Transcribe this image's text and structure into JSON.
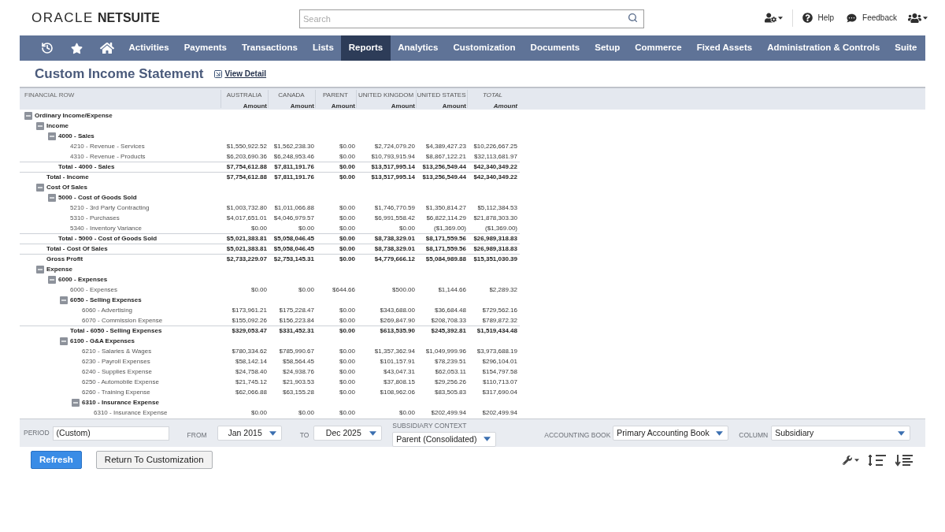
{
  "header": {
    "logo": {
      "brand": "ORACLE",
      "product": "NETSUITE"
    },
    "search": {
      "placeholder": "Search"
    },
    "help_label": "Help",
    "feedback_label": "Feedback"
  },
  "nav": {
    "items": [
      {
        "label": "Activities",
        "selected": false
      },
      {
        "label": "Payments",
        "selected": false
      },
      {
        "label": "Transactions",
        "selected": false
      },
      {
        "label": "Lists",
        "selected": false
      },
      {
        "label": "Reports",
        "selected": true
      },
      {
        "label": "Analytics",
        "selected": false
      },
      {
        "label": "Customization",
        "selected": false
      },
      {
        "label": "Documents",
        "selected": false
      },
      {
        "label": "Setup",
        "selected": false
      },
      {
        "label": "Commerce",
        "selected": false
      },
      {
        "label": "Fixed Assets",
        "selected": false
      },
      {
        "label": "Administration & Controls",
        "selected": false
      },
      {
        "label": "Suite",
        "selected": false
      }
    ]
  },
  "page_title": "Custom Income Statement",
  "view_detail_link": "View Detail",
  "table": {
    "label_column": "FINANCIAL ROW",
    "columns": [
      {
        "name": "AUSTRALIA",
        "sub": "Amount",
        "kind": "subsidiary"
      },
      {
        "name": "CANADA",
        "sub": "Amount",
        "kind": "subsidiary"
      },
      {
        "name": "PARENT",
        "sub": "Amount",
        "kind": "subsidiary"
      },
      {
        "name": "UNITED KINGDOM",
        "sub": "Amount",
        "kind": "subsidiary"
      },
      {
        "name": "UNITED STATES",
        "sub": "Amount",
        "kind": "subsidiary"
      },
      {
        "name": "TOTAL",
        "sub": "Amount",
        "kind": "total"
      }
    ],
    "rows": [
      {
        "label": "Ordinary Income/Expense",
        "kind": "group",
        "expanded": true,
        "children": [
          {
            "label": "Income",
            "kind": "group",
            "expanded": true,
            "children": [
              {
                "label": "4000 - Sales",
                "kind": "group",
                "expanded": true,
                "children": [
                  {
                    "label": "4210 - Revenue - Services",
                    "kind": "account",
                    "amounts": [
                      "$1,550,922.52",
                      "$1,562,238.30",
                      "$0.00",
                      "$2,724,079.20",
                      "$4,389,427.23",
                      "$10,226,667.25"
                    ]
                  },
                  {
                    "label": "4310 - Revenue - Products",
                    "kind": "account",
                    "amounts": [
                      "$6,203,690.36",
                      "$6,248,953.46",
                      "$0.00",
                      "$10,793,915.94",
                      "$8,867,122.21",
                      "$32,113,681.97"
                    ]
                  }
                ],
                "total": {
                  "label": "Total - 4000 - Sales",
                  "amounts": [
                    "$7,754,612.88",
                    "$7,811,191.76",
                    "$0.00",
                    "$13,517,995.14",
                    "$13,256,549.44",
                    "$42,340,349.22"
                  ]
                }
              }
            ],
            "total": {
              "label": "Total - Income",
              "amounts": [
                "$7,754,612.88",
                "$7,811,191.76",
                "$0.00",
                "$13,517,995.14",
                "$13,256,549.44",
                "$42,340,349.22"
              ]
            }
          },
          {
            "label": "Cost Of Sales",
            "kind": "group",
            "expanded": true,
            "children": [
              {
                "label": "5000 - Cost of Goods Sold",
                "kind": "group",
                "expanded": true,
                "children": [
                  {
                    "label": "5210 - 3rd Party Contracting",
                    "kind": "account",
                    "amounts": [
                      "$1,003,732.80",
                      "$1,011,066.88",
                      "$0.00",
                      "$1,746,770.59",
                      "$1,350,814.27",
                      "$5,112,384.53"
                    ]
                  },
                  {
                    "label": "5310 - Purchases",
                    "kind": "account",
                    "amounts": [
                      "$4,017,651.01",
                      "$4,046,979.57",
                      "$0.00",
                      "$6,991,558.42",
                      "$6,822,114.29",
                      "$21,878,303.30"
                    ]
                  },
                  {
                    "label": "5340 - Inventory Variance",
                    "kind": "account",
                    "amounts": [
                      "$0.00",
                      "$0.00",
                      "$0.00",
                      "$0.00",
                      "($1,369.00)",
                      "($1,369.00)"
                    ]
                  }
                ],
                "total": {
                  "label": "Total - 5000 - Cost of Goods Sold",
                  "amounts": [
                    "$5,021,383.81",
                    "$5,058,046.45",
                    "$0.00",
                    "$8,738,329.01",
                    "$8,171,559.56",
                    "$26,989,318.83"
                  ]
                }
              }
            ],
            "total": {
              "label": "Total - Cost Of Sales",
              "amounts": [
                "$5,021,383.81",
                "$5,058,046.45",
                "$0.00",
                "$8,738,329.01",
                "$8,171,559.56",
                "$26,989,318.83"
              ]
            }
          },
          {
            "label": "Gross Profit",
            "kind": "total",
            "amounts": [
              "$2,733,229.07",
              "$2,753,145.31",
              "$0.00",
              "$4,779,666.12",
              "$5,084,989.88",
              "$15,351,030.39"
            ]
          },
          {
            "label": "Expense",
            "kind": "group",
            "expanded": true,
            "children": [
              {
                "label": "6000 - Expenses",
                "kind": "group",
                "expanded": true,
                "children": [
                  {
                    "label": "6000 - Expenses",
                    "kind": "account",
                    "amounts": [
                      "$0.00",
                      "$0.00",
                      "$644.66",
                      "$500.00",
                      "$1,144.66",
                      "$2,289.32"
                    ]
                  },
                  {
                    "label": "6050 - Selling Expenses",
                    "kind": "group",
                    "expanded": true,
                    "children": [
                      {
                        "label": "6060 - Advertising",
                        "kind": "account",
                        "amounts": [
                          "$173,961.21",
                          "$175,228.47",
                          "$0.00",
                          "$343,688.00",
                          "$36,684.48",
                          "$729,562.16"
                        ]
                      },
                      {
                        "label": "6070 - Commission Expense",
                        "kind": "account",
                        "amounts": [
                          "$155,092.26",
                          "$156,223.84",
                          "$0.00",
                          "$269,847.90",
                          "$208,708.33",
                          "$789,872.32"
                        ]
                      }
                    ],
                    "total": {
                      "label": "Total - 6050 - Selling Expenses",
                      "amounts": [
                        "$329,053.47",
                        "$331,452.31",
                        "$0.00",
                        "$613,535.90",
                        "$245,392.81",
                        "$1,519,434.48"
                      ]
                    }
                  },
                  {
                    "label": "6100 - G&A Expenses",
                    "kind": "group",
                    "expanded": true,
                    "children": [
                      {
                        "label": "6210 - Salaries & Wages",
                        "kind": "account",
                        "amounts": [
                          "$780,334.62",
                          "$785,990.67",
                          "$0.00",
                          "$1,357,362.94",
                          "$1,049,999.96",
                          "$3,973,688.19"
                        ]
                      },
                      {
                        "label": "6230 - Payroll Expenses",
                        "kind": "account",
                        "amounts": [
                          "$58,142.14",
                          "$58,564.45",
                          "$0.00",
                          "$101,157.91",
                          "$78,239.51",
                          "$296,104.01"
                        ]
                      },
                      {
                        "label": "6240 - Supplies Expense",
                        "kind": "account",
                        "amounts": [
                          "$24,758.40",
                          "$24,938.76",
                          "$0.00",
                          "$43,047.31",
                          "$62,053.11",
                          "$154,797.58"
                        ]
                      },
                      {
                        "label": "6250 - Automobile Expense",
                        "kind": "account",
                        "amounts": [
                          "$21,745.12",
                          "$21,903.53",
                          "$0.00",
                          "$37,808.15",
                          "$29,256.26",
                          "$110,713.07"
                        ]
                      },
                      {
                        "label": "6260 - Training Expense",
                        "kind": "account",
                        "amounts": [
                          "$62,066.88",
                          "$63,155.28",
                          "$0.00",
                          "$108,962.06",
                          "$83,505.83",
                          "$317,690.04"
                        ]
                      },
                      {
                        "label": "6310 - Insurance Expense",
                        "kind": "group",
                        "expanded": true,
                        "children": [
                          {
                            "label": "6310 - Insurance Expense",
                            "kind": "account",
                            "amounts": [
                              "$0.00",
                              "$0.00",
                              "$0.00",
                              "$0.00",
                              "$202,499.94",
                              "$202,499.94"
                            ]
                          }
                        ]
                      }
                    ]
                  }
                ]
              }
            ]
          }
        ]
      }
    ]
  },
  "filters": {
    "period": {
      "label": "PERIOD",
      "value": "(Custom)"
    },
    "from": {
      "label": "FROM",
      "value": "Jan 2015"
    },
    "to": {
      "label": "TO",
      "value": "Dec 2025"
    },
    "subsidiary_context": {
      "label": "SUBSIDIARY CONTEXT",
      "value": "Parent (Consolidated)"
    },
    "accounting_book": {
      "label": "ACCOUNTING BOOK",
      "value": "Primary Accounting Book"
    },
    "column": {
      "label": "COLUMN",
      "value": "Subsidiary"
    }
  },
  "buttons": [
    {
      "label": "Refresh",
      "kind": "primary"
    },
    {
      "label": "Return To Customization",
      "kind": "secondary"
    }
  ]
}
